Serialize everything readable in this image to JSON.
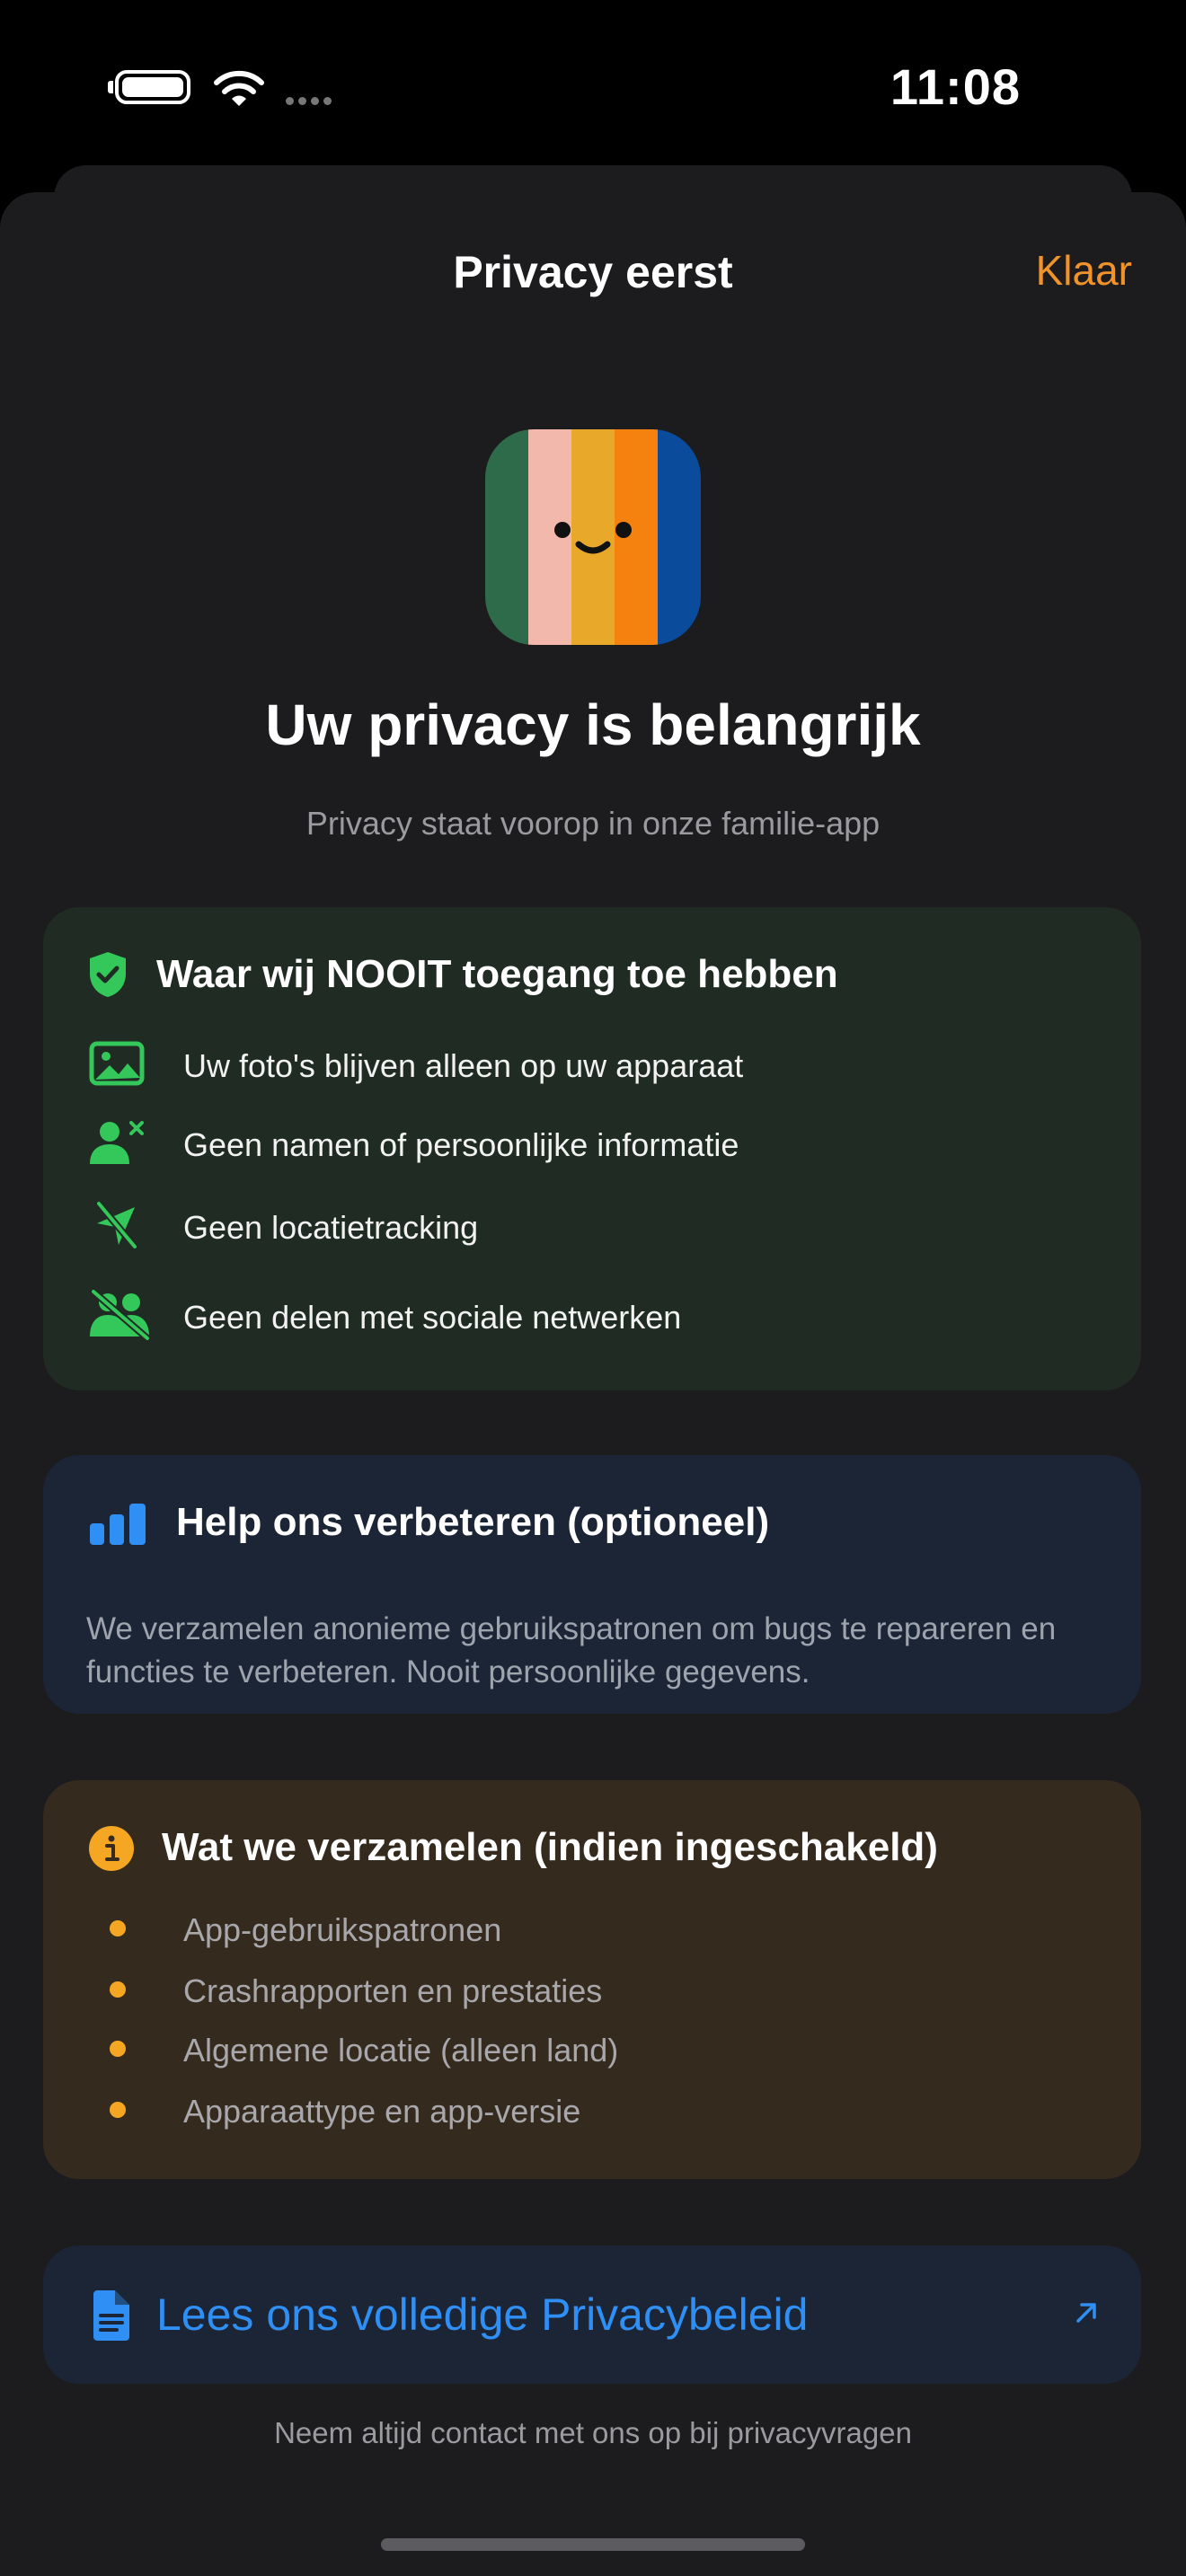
{
  "status_bar": {
    "time": "11:08"
  },
  "nav": {
    "title": "Privacy eerst",
    "done_label": "Klaar"
  },
  "app_icon": {
    "stripe_colors": [
      "#2e6b4a",
      "#f2b8ac",
      "#e8a82a",
      "#f5820f",
      "#0a4c9b"
    ]
  },
  "hero": {
    "title": "Uw privacy is belangrijk",
    "subtitle": "Privacy staat voorop in onze familie-app"
  },
  "never_card": {
    "title": "Waar wij NOOIT toegang toe hebben",
    "accent": "#34c759",
    "items": [
      {
        "icon": "photo-icon",
        "label": "Uw foto's blijven alleen op uw apparaat"
      },
      {
        "icon": "person-xmark-icon",
        "label": "Geen namen of persoonlijke informatie"
      },
      {
        "icon": "location-slash-icon",
        "label": "Geen locatietracking"
      },
      {
        "icon": "people-slash-icon",
        "label": "Geen delen met sociale netwerken"
      }
    ]
  },
  "help_card": {
    "title": "Help ons verbeteren (optioneel)",
    "body": "We verzamelen anonieme gebruikspatronen om bugs te repareren en functies te verbeteren. Nooit persoonlijke gegevens.",
    "accent": "#2f8ff4"
  },
  "collect_card": {
    "title": "Wat we verzamelen (indien ingeschakeld)",
    "accent": "#f5a623",
    "items": [
      "App-gebruikspatronen",
      "Crashrapporten en prestaties",
      "Algemene locatie (alleen land)",
      "Apparaattype en app-versie"
    ]
  },
  "policy_card": {
    "label": "Lees ons volledige Privacybeleid"
  },
  "footer": {
    "text": "Neem altijd contact met ons op bij privacyvragen"
  }
}
